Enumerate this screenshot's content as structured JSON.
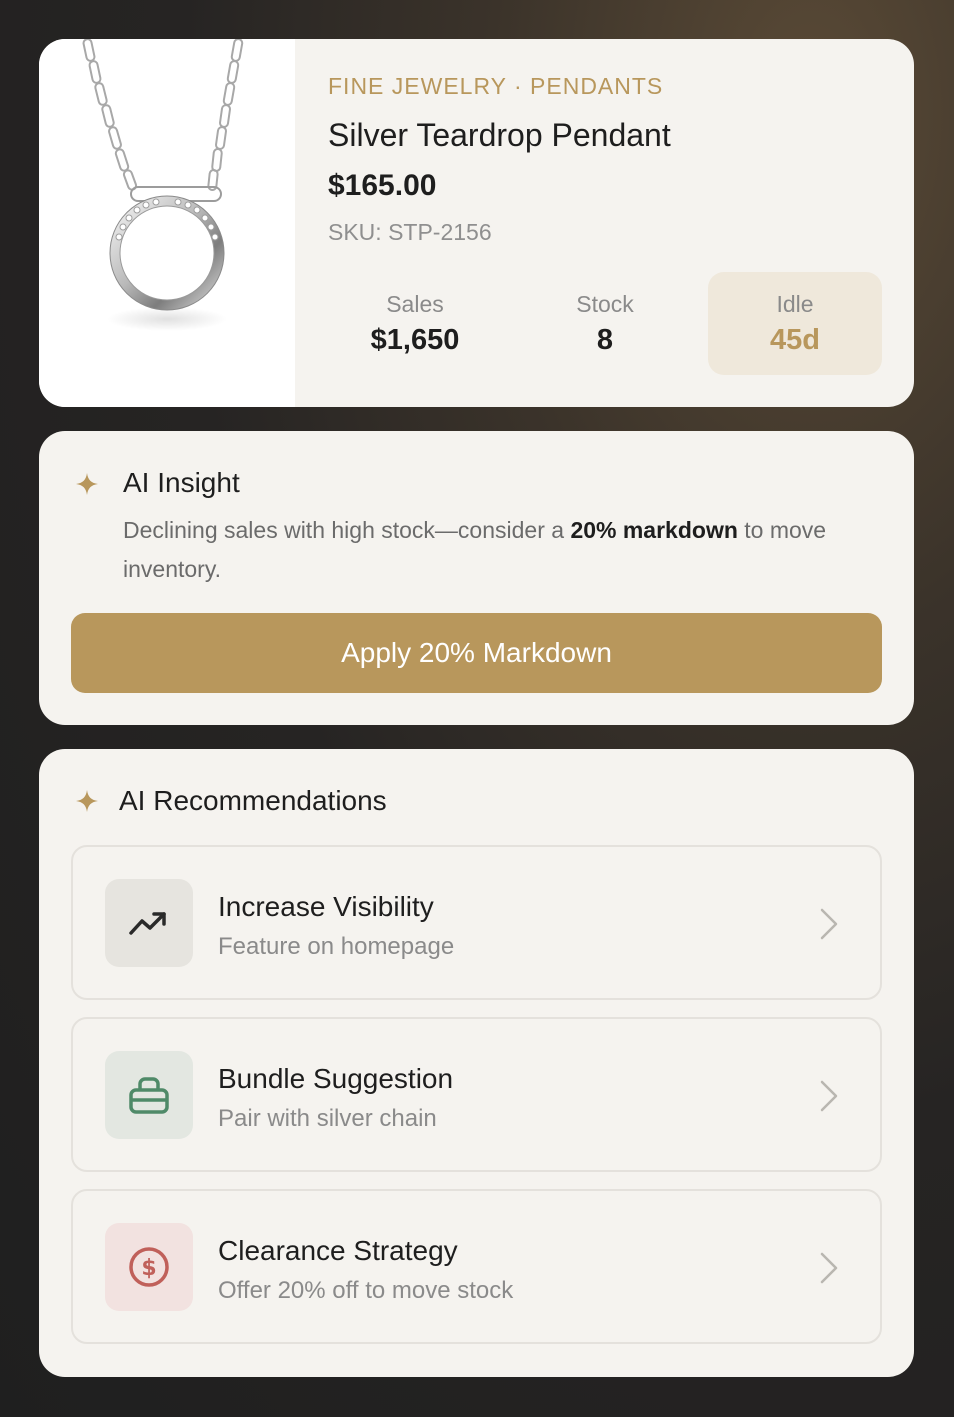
{
  "product": {
    "category": "FINE JEWELRY · PENDANTS",
    "title": "Silver Teardrop Pendant",
    "price": "$165.00",
    "sku": "SKU: STP-2156",
    "stats": [
      {
        "label": "Sales",
        "value": "$1,650"
      },
      {
        "label": "Stock",
        "value": "8"
      },
      {
        "label": "Idle",
        "value": "45d"
      }
    ]
  },
  "insight": {
    "heading": "AI Insight",
    "text_before": "Declining sales with high stock—consider a ",
    "text_bold": "20% markdown",
    "text_after": " to move inventory.",
    "button_label": "Apply 20% Markdown"
  },
  "recommendations": {
    "heading": "AI Recommendations",
    "items": [
      {
        "title": "Increase Visibility",
        "subtitle": "Feature on homepage",
        "icon": "trending-up-icon"
      },
      {
        "title": "Bundle Suggestion",
        "subtitle": "Pair with silver chain",
        "icon": "bundle-icon"
      },
      {
        "title": "Clearance Strategy",
        "subtitle": "Offer 20% off to move stock",
        "icon": "dollar-circle-icon"
      }
    ]
  },
  "colors": {
    "accent": "#b8975c",
    "card_bg": "#f5f3ef",
    "idle_bg": "#efe8db",
    "green_icon": "#4f8a68",
    "red_icon": "#c0605a"
  }
}
